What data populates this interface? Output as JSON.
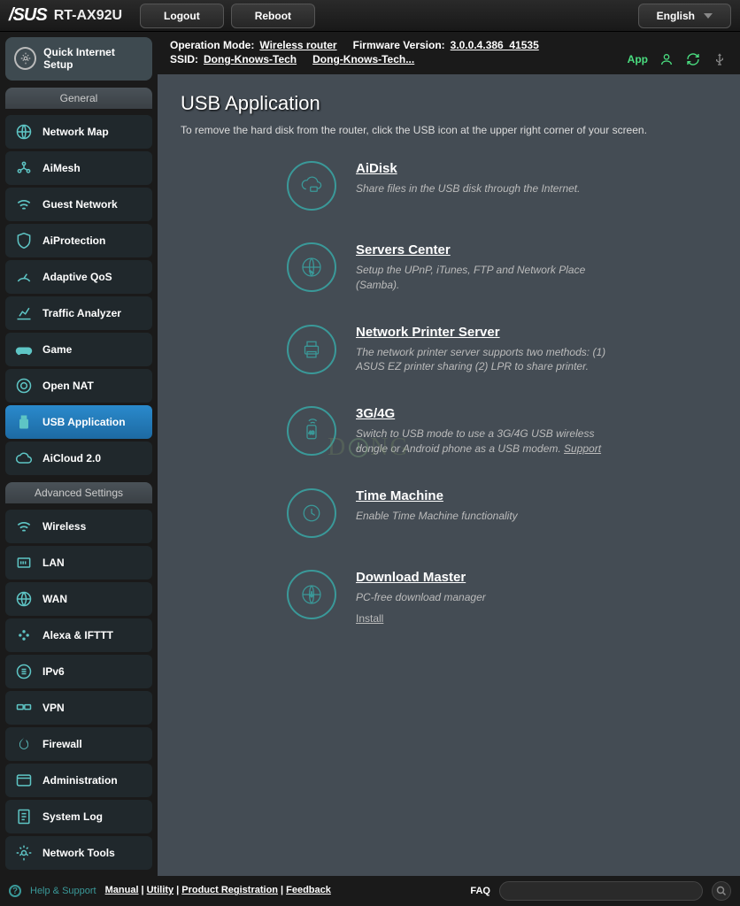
{
  "header": {
    "brand": "/SUS",
    "model": "RT-AX92U",
    "logout": "Logout",
    "reboot": "Reboot",
    "language": "English"
  },
  "status": {
    "op_mode_label": "Operation Mode:",
    "op_mode_value": "Wireless router",
    "fw_label": "Firmware Version:",
    "fw_value": "3.0.0.4.386_41535",
    "ssid_label": "SSID:",
    "ssid1": "Dong-Knows-Tech",
    "ssid2": "Dong-Knows-Tech...",
    "app": "App"
  },
  "qis": {
    "label": "Quick Internet Setup"
  },
  "general": {
    "header": "General",
    "items": [
      {
        "label": "Network Map"
      },
      {
        "label": "AiMesh"
      },
      {
        "label": "Guest Network"
      },
      {
        "label": "AiProtection"
      },
      {
        "label": "Adaptive QoS"
      },
      {
        "label": "Traffic Analyzer"
      },
      {
        "label": "Game"
      },
      {
        "label": "Open NAT"
      },
      {
        "label": "USB Application"
      },
      {
        "label": "AiCloud 2.0"
      }
    ]
  },
  "advanced": {
    "header": "Advanced Settings",
    "items": [
      {
        "label": "Wireless"
      },
      {
        "label": "LAN"
      },
      {
        "label": "WAN"
      },
      {
        "label": "Alexa & IFTTT"
      },
      {
        "label": "IPv6"
      },
      {
        "label": "VPN"
      },
      {
        "label": "Firewall"
      },
      {
        "label": "Administration"
      },
      {
        "label": "System Log"
      },
      {
        "label": "Network Tools"
      }
    ]
  },
  "page": {
    "title": "USB Application",
    "desc": "To remove the hard disk from the router, click the USB icon at the upper right corner of your screen."
  },
  "apps": [
    {
      "title": "AiDisk",
      "desc": "Share files in the USB disk through the Internet."
    },
    {
      "title": "Servers Center",
      "desc": "Setup the UPnP, iTunes, FTP and Network Place (Samba)."
    },
    {
      "title": "Network Printer Server",
      "desc": "The network printer server supports two methods: (1) ASUS EZ printer sharing (2) LPR to share printer."
    },
    {
      "title": "3G/4G",
      "desc": "Switch to USB mode to use a 3G/4G USB wireless dongle or Android phone as a USB modem. ",
      "link": "Support"
    },
    {
      "title": "Time Machine",
      "desc": "Enable Time Machine functionality"
    },
    {
      "title": "Download Master",
      "desc": "PC-free download manager",
      "install": "Install"
    }
  ],
  "footer": {
    "help": "Help & Support",
    "links": {
      "manual": "Manual",
      "utility": "Utility",
      "product": "Product Registration",
      "feedback": "Feedback"
    },
    "faq": "FAQ"
  }
}
